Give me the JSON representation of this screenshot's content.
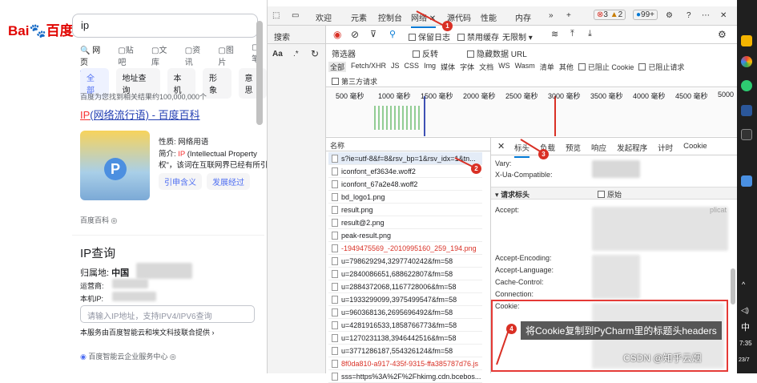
{
  "browser": {
    "logo": "Bai",
    "logo2": "百度",
    "search_value": "ip",
    "tabs": [
      "网页",
      "贴吧",
      "文库",
      "资讯",
      "图片",
      "笔"
    ],
    "chips": [
      "全部",
      "地址查询",
      "本机",
      "形象",
      "意思"
    ],
    "result_count": "百度为您找到相关结果约100,000,000个",
    "result_title_red": "IP",
    "result_title_rest": "(网络流行语) - 百度百科",
    "prop1_label": "性质:",
    "prop1_value": "网络用语",
    "prop2_label": "简介:",
    "prop2_red": "IP",
    "prop2_value": "(Intellectual Property",
    "prop3": "权\"，该词在互联网界已经有所引",
    "btn1": "引申含义",
    "btn2": "发展经过",
    "source": "百度百科",
    "ip_title": "IP查询",
    "ip_loc_label": "归属地:",
    "ip_loc_value": "中国",
    "isp_label": "运营商:",
    "local_label": "本机IP:",
    "ip_placeholder": "请输入IP地址，支持IPV4/IPV6查询",
    "ip_provider": "本服务由百度智能云和埃文科技联合提供 ›",
    "bottom_link": "百度智能云企业服务中心"
  },
  "devtools": {
    "tabs": [
      "欢迎",
      "元素",
      "控制台",
      "网络",
      "源代码",
      "性能",
      "内存"
    ],
    "errors": "3",
    "warnings": "2",
    "issues": "99+",
    "side_label": "搜索",
    "toolbar": {
      "preserve": "保留日志",
      "disable_cache": "禁用缓存",
      "throttle": "无限制"
    },
    "filter_placeholder": "筛选器",
    "invert": "反转",
    "hide_data": "隐藏数据 URL",
    "types": [
      "全部",
      "Fetch/XHR",
      "JS",
      "CSS",
      "Img",
      "媒体",
      "字体",
      "文档",
      "WS",
      "Wasm",
      "清单",
      "其他"
    ],
    "blocked_cookies": "已阻止 Cookie",
    "blocked_requests": "已阻止请求",
    "third_party": "第三方请求",
    "timeline": [
      "500 毫秒",
      "1000 毫秒",
      "1500 毫秒",
      "2000 毫秒",
      "2500 毫秒",
      "3000 毫秒",
      "3500 毫秒",
      "4000 毫秒",
      "4500 毫秒",
      "5000"
    ],
    "name_header": "名称",
    "requests": [
      "s?ie=utf-8&f=8&rsv_bp=1&rsv_idx=1&tn...",
      "iconfont_ef3634e.woff2",
      "iconfont_67a2e48.woff2",
      "bd_logo1.png",
      "result.png",
      "result@2.png",
      "peak-result.png",
      "-1949475569_-2010995160_259_194.png",
      "u=798629294,3297740242&fm=58",
      "u=2840086651,688622807&fm=58",
      "u=2884372068,1167728006&fm=58",
      "u=1933299099,3975499547&fm=58",
      "u=960368136,2695696492&fm=58",
      "u=4281916533,1858766773&fm=58",
      "u=1270231138,3946442516&fm=58",
      "u=3771286187,554326124&fm=58",
      "8f0da810-a917-435f-9315-ffa385787d76.js",
      "sss=https%3A%2F%2Fhkimg.cdn.bcebos..."
    ],
    "detail_tabs": [
      "标头",
      "负载",
      "预览",
      "响应",
      "发起程序",
      "计时",
      "Cookie"
    ],
    "resp_rows": [
      "Vary:",
      "X-Ua-Compatible:"
    ],
    "req_section": "请求标头",
    "raw": "原始",
    "req_rows": [
      "Accept:",
      "Accept-Encoding:",
      "Accept-Language:",
      "Cache-Control:",
      "Connection:",
      "Cookie:"
    ],
    "accept_tail": "plicat"
  },
  "annotations": {
    "n1": "1",
    "n2": "2",
    "n3": "3",
    "n4": "4",
    "callout": "将Cookie复制到PyCharm里的标题头headers"
  },
  "watermark": "CSDN @知乎云烟",
  "taskbar": {
    "char": "中",
    "time": "7:35",
    "date": "23/7"
  }
}
